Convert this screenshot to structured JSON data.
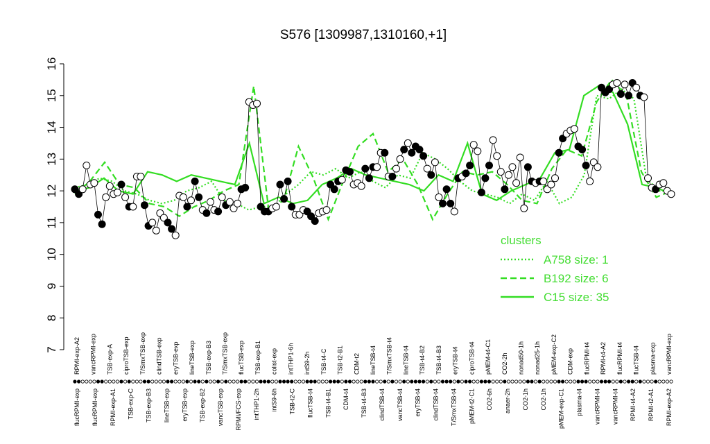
{
  "chart_data": {
    "type": "scatter",
    "title": "S576 [1309987,1310160,+1]",
    "xlabel": "",
    "ylabel": "",
    "ylim": [
      7,
      16
    ],
    "yticks": [
      7,
      8,
      9,
      10,
      11,
      12,
      13,
      14,
      15,
      16
    ],
    "colors": {
      "points_filled": "#000000",
      "points_open": "#ffffff",
      "cluster_lines": "#33dd22"
    },
    "x_labels_top": [
      "RPMI-exp-A2",
      "vancRPMI-exp",
      "TSB-exp-A",
      "ciproTSB-exp",
      "T/SmxTSB-exp",
      "clindTSB-exp",
      "eryTSB-exp",
      "lineTSB-exp",
      "TSB-exp-B3",
      "T/SmxTSB-exp",
      "flucTSB-exp",
      "TSB-exp-B1",
      "colist-exp",
      "intTHP1-6h",
      "intS9-2h",
      "TSB-t4-C",
      "TSB-t2-B1",
      "CDM-t2",
      "lineTSB-t4",
      "T/SmxTSB-t4",
      "lineTSB-t4",
      "TSB-t4-B2",
      "TSB-t4-B3",
      "eryTSB-t4",
      "ciproTSB-t4",
      "pMEM-t4-C1",
      "CO2-2h",
      "nonad50-1h",
      "nonad25-1h",
      "pMEM-exp-C2",
      "CDM-exp",
      "flucRPMI-t4",
      "RPMI-t4-A2",
      "flucRPMI-t4",
      "flucTSB-t4",
      "plasma-exp",
      "vancRPMI-exp"
    ],
    "x_labels_bottom": [
      "flucRPMI-exp",
      "flucRPMI-exp",
      "RPMI-exp-A1",
      "TSB-exp-C",
      "TSB-exp-B3",
      "lineTSB-exp",
      "eryTSB-exp",
      "TSB-exp-B2",
      "vancTSB-exp",
      "RPMI/FCS-exp",
      "intTHP1-2h",
      "intS9-6h",
      "TSB-t2-C",
      "flucTSB-t4",
      "TSB-t4-B1",
      "CDM-t4",
      "TSB-t4-B3",
      "clindTSB-t4",
      "vancTSB-t4",
      "eryTSB-t4",
      "clindTSB-t4",
      "T/SmxTSB-t4",
      "pMEM-t2-C1",
      "CO2-6h",
      "anaer-2h",
      "CO2-1h",
      "CO2-1h",
      "pMEM-exp-C1",
      "plasma-t4",
      "vancRPMI-t4",
      "vancRPMI-t4",
      "RPMI-t4-A2",
      "RPMI-t2-A1",
      "RPMI-exp-A2"
    ],
    "series": [
      {
        "name": "A758 size: 1",
        "style": "dotted",
        "values": [
          12.1,
          12.2,
          12.4,
          12.3,
          12.0,
          11.9,
          11.7,
          11.6,
          11.7,
          12.0,
          12.1,
          12.3,
          11.7,
          11.6,
          11.4,
          11.5,
          11.5,
          11.9,
          12.2,
          12.6,
          12.5,
          12.7,
          12.4,
          12.6,
          12.3,
          12.1,
          12.5,
          12.4,
          13.2,
          13.0,
          12.7,
          12.3,
          12.0,
          11.9,
          11.8,
          11.6,
          11.9,
          11.7,
          12.3,
          11.6,
          11.8,
          12.5,
          15.0,
          14.9,
          15.2,
          14.9,
          12.4,
          12.0,
          12.0
        ]
      },
      {
        "name": "B192 size: 6",
        "style": "dashed",
        "values": [
          11.9,
          12.3,
          12.9,
          12.2,
          12.1,
          11.6,
          11.5,
          11.2,
          11.5,
          11.7,
          12.0,
          12.2,
          15.3,
          11.4,
          11.7,
          13.4,
          12.4,
          11.1,
          12.3,
          13.4,
          13.8,
          12.6,
          13.0,
          12.2,
          11.1,
          11.9,
          12.6,
          12.5,
          12.6,
          12.2,
          11.7,
          11.6,
          12.7,
          13.3,
          13.1,
          14.8,
          15.5,
          15.0,
          12.6,
          11.8,
          12.0
        ]
      },
      {
        "name": "C15 size: 35",
        "style": "solid",
        "values": [
          12.0,
          12.1,
          12.4,
          12.0,
          11.9,
          12.6,
          12.5,
          12.3,
          12.5,
          12.4,
          12.3,
          12.2,
          13.5,
          11.6,
          11.8,
          11.6,
          11.7,
          12.2,
          12.4,
          12.7,
          12.5,
          12.4,
          12.3,
          12.2,
          12.0,
          12.5,
          12.3,
          13.5,
          11.9,
          11.7,
          12.0,
          12.2,
          12.4,
          13.2,
          13.3,
          15.0,
          15.3,
          15.1,
          14.1,
          12.2,
          12.1,
          11.9
        ]
      }
    ],
    "points": [
      12.05,
      11.9,
      12.05,
      12.8,
      12.2,
      12.25,
      11.25,
      10.95,
      11.8,
      12.15,
      11.9,
      11.95,
      12.2,
      11.8,
      11.5,
      11.5,
      12.45,
      12.45,
      11.55,
      10.9,
      11.0,
      10.75,
      11.3,
      11.15,
      11.0,
      10.8,
      10.6,
      11.85,
      11.8,
      11.5,
      11.7,
      12.3,
      11.8,
      11.4,
      11.3,
      11.65,
      11.4,
      11.35,
      11.8,
      11.55,
      11.65,
      11.45,
      11.6,
      12.05,
      12.1,
      14.8,
      14.7,
      14.75,
      11.5,
      11.35,
      11.35,
      11.45,
      11.5,
      12.2,
      11.75,
      12.3,
      11.5,
      11.25,
      11.25,
      11.4,
      11.35,
      11.2,
      11.05,
      11.3,
      11.35,
      11.4,
      12.2,
      12.05,
      12.3,
      12.35,
      12.65,
      12.6,
      12.2,
      12.25,
      12.15,
      12.7,
      12.4,
      12.75,
      12.75,
      13.2,
      13.2,
      12.45,
      12.45,
      12.7,
      13.0,
      13.3,
      13.5,
      13.2,
      13.4,
      13.3,
      13.1,
      12.7,
      12.5,
      12.9,
      11.8,
      11.6,
      12.05,
      11.6,
      11.35,
      12.4,
      12.45,
      12.55,
      12.8,
      13.45,
      13.25,
      11.95,
      12.4,
      12.8,
      13.6,
      13.1,
      12.6,
      12.05,
      12.5,
      12.75,
      12.25,
      13.05,
      11.45,
      12.75,
      12.3,
      12.25,
      12.3,
      12.3,
      12.05,
      12.2,
      12.4,
      13.2,
      13.65,
      13.8,
      13.9,
      13.95,
      13.4,
      13.3,
      12.8,
      12.3,
      12.9,
      12.75,
      15.25,
      15.1,
      15.2,
      15.35,
      15.4,
      15.05,
      15.35,
      15.0,
      15.4,
      15.25,
      15.0,
      14.95,
      12.4,
      12.1,
      12.05,
      12.2,
      12.25,
      12.0,
      11.9
    ],
    "points_filled": [
      true,
      true,
      false,
      false,
      false,
      false,
      true,
      true,
      false,
      false,
      false,
      false,
      true,
      false,
      true,
      false,
      false,
      false,
      true,
      true,
      false,
      false,
      false,
      false,
      true,
      true,
      false,
      false,
      false,
      true,
      false,
      true,
      true,
      false,
      true,
      false,
      false,
      true,
      false,
      true,
      false,
      false,
      false,
      true,
      true,
      false,
      false,
      false,
      true,
      true,
      true,
      false,
      false,
      true,
      true,
      true,
      true,
      false,
      false,
      false,
      true,
      true,
      true,
      false,
      false,
      false,
      true,
      true,
      true,
      false,
      true,
      true,
      false,
      false,
      false,
      true,
      true,
      true,
      false,
      false,
      true,
      false,
      true,
      false,
      false,
      true,
      false,
      true,
      true,
      true,
      true,
      false,
      true,
      false,
      false,
      true,
      true,
      true,
      false,
      true,
      false,
      true,
      true,
      false,
      false,
      true,
      true,
      true,
      false,
      false,
      false,
      true,
      false,
      false,
      false,
      false,
      false,
      true,
      true,
      false,
      true,
      false,
      false,
      false,
      false,
      true,
      true,
      false,
      false,
      false,
      true,
      true,
      true,
      false,
      false,
      false,
      true,
      true,
      true,
      false,
      false,
      true,
      false,
      true,
      true,
      false,
      true,
      false,
      false,
      false,
      true,
      false,
      false,
      false,
      false,
      false,
      false
    ]
  },
  "legend": {
    "title": "clusters",
    "entries": [
      {
        "label": "A758 size: 1",
        "style": "dotted"
      },
      {
        "label": "B192 size: 6",
        "style": "dashed"
      },
      {
        "label": "C15 size: 35",
        "style": "solid"
      }
    ],
    "placement": "right-middle"
  }
}
